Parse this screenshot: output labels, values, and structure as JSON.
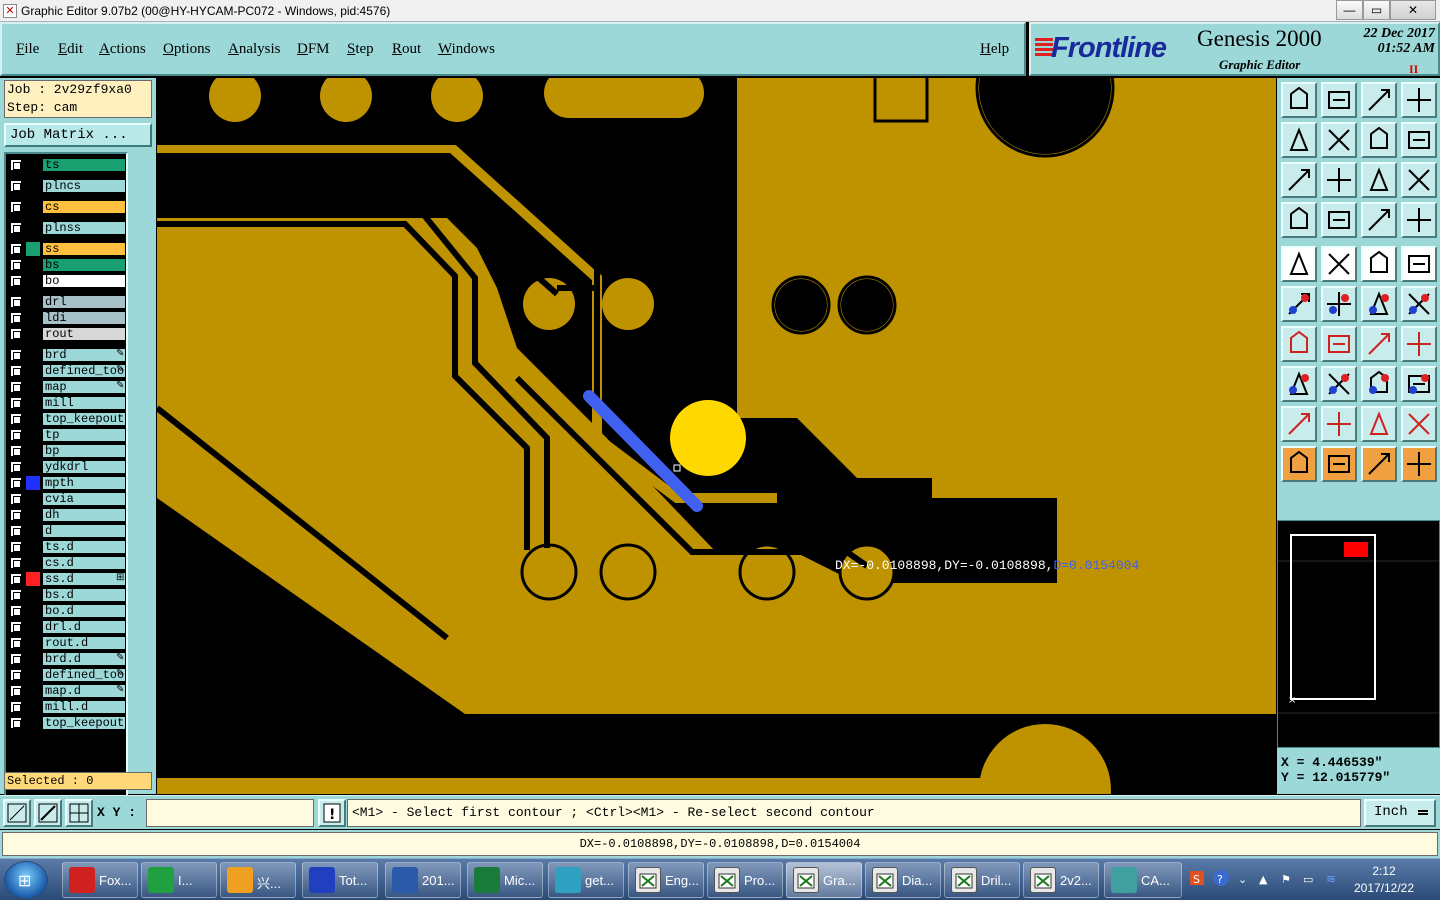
{
  "window": {
    "title": "Graphic Editor 9.07b2 (00@HY-HYCAM-PC072 - Windows, pid:4576)",
    "controls": [
      "—",
      "▭",
      "✕"
    ]
  },
  "menu": {
    "items": [
      "File",
      "Edit",
      "Actions",
      "Options",
      "Analysis",
      "DFM",
      "Step",
      "Rout",
      "Windows"
    ],
    "help": "Help"
  },
  "brand": {
    "logo": "Frontline",
    "product": "Genesis 2000",
    "date": "22 Dec 2017",
    "time": "01:52 AM",
    "subtitle": "Graphic Editor",
    "pause": "II"
  },
  "job": {
    "job_line": "Job : 2v29zf9xa0",
    "step_line": "Step: cam",
    "matrix_button": "Job Matrix ..."
  },
  "layers": [
    {
      "name": "ts",
      "bg": "#1aa070",
      "swatch": "#000000",
      "tag": ""
    },
    {
      "name": "plncs",
      "bg": "#9cd8d8",
      "swatch": "#000000",
      "tag": ""
    },
    {
      "name": "cs",
      "bg": "#ffc040",
      "swatch": "#000000",
      "tag": ""
    },
    {
      "name": "plnss",
      "bg": "#9cd8d8",
      "swatch": "#000000",
      "tag": ""
    },
    {
      "name": "ss",
      "bg": "#ffc040",
      "swatch": "#1aa070",
      "tag": ""
    },
    {
      "name": "bs",
      "bg": "#1aa070",
      "swatch": "#000000",
      "tag": ""
    },
    {
      "name": "bo",
      "bg": "#ffffff",
      "swatch": "#000000",
      "tag": ""
    },
    {
      "name": "drl",
      "bg": "#a8c0c8",
      "swatch": "#000000",
      "tag": ""
    },
    {
      "name": "ldi",
      "bg": "#a8c0c8",
      "swatch": "#000000",
      "tag": ""
    },
    {
      "name": "rout",
      "bg": "#d8d8d8",
      "swatch": "#000000",
      "tag": ""
    },
    {
      "name": "brd",
      "bg": "#9cd8d8",
      "swatch": "#000000",
      "tag": "✎"
    },
    {
      "name": "defined_tool",
      "bg": "#9cd8d8",
      "swatch": "#000000",
      "tag": "✎"
    },
    {
      "name": "map",
      "bg": "#9cd8d8",
      "swatch": "#000000",
      "tag": "✎"
    },
    {
      "name": "mill",
      "bg": "#9cd8d8",
      "swatch": "#000000",
      "tag": ""
    },
    {
      "name": "top_keepout",
      "bg": "#9cd8d8",
      "swatch": "#000000",
      "tag": ""
    },
    {
      "name": "tp",
      "bg": "#9cd8d8",
      "swatch": "#000000",
      "tag": ""
    },
    {
      "name": "bp",
      "bg": "#9cd8d8",
      "swatch": "#000000",
      "tag": ""
    },
    {
      "name": "ydkdrl",
      "bg": "#9cd8d8",
      "swatch": "#000000",
      "tag": ""
    },
    {
      "name": "mpth",
      "bg": "#9cd8d8",
      "swatch": "#2030ff",
      "tag": ""
    },
    {
      "name": "cvia",
      "bg": "#9cd8d8",
      "swatch": "#000000",
      "tag": ""
    },
    {
      "name": "dh",
      "bg": "#9cd8d8",
      "swatch": "#000000",
      "tag": ""
    },
    {
      "name": "d",
      "bg": "#9cd8d8",
      "swatch": "#000000",
      "tag": ""
    },
    {
      "name": "ts.d",
      "bg": "#9cd8d8",
      "swatch": "#000000",
      "tag": ""
    },
    {
      "name": "cs.d",
      "bg": "#9cd8d8",
      "swatch": "#000000",
      "tag": ""
    },
    {
      "name": "ss.d",
      "bg": "#9cd8d8",
      "swatch": "#ff2020",
      "tag": "⊞"
    },
    {
      "name": "bs.d",
      "bg": "#9cd8d8",
      "swatch": "#000000",
      "tag": ""
    },
    {
      "name": "bo.d",
      "bg": "#9cd8d8",
      "swatch": "#000000",
      "tag": ""
    },
    {
      "name": "drl.d",
      "bg": "#9cd8d8",
      "swatch": "#000000",
      "tag": ""
    },
    {
      "name": "rout.d",
      "bg": "#9cd8d8",
      "swatch": "#000000",
      "tag": ""
    },
    {
      "name": "brd.d",
      "bg": "#9cd8d8",
      "swatch": "#000000",
      "tag": "✎"
    },
    {
      "name": "defined_tool",
      "bg": "#9cd8d8",
      "swatch": "#000000",
      "tag": "✎"
    },
    {
      "name": "map.d",
      "bg": "#9cd8d8",
      "swatch": "#000000",
      "tag": "✎"
    },
    {
      "name": "mill.d",
      "bg": "#9cd8d8",
      "swatch": "#000000",
      "tag": ""
    },
    {
      "name": "top_keepout",
      "bg": "#9cd8d8",
      "swatch": "#000000",
      "tag": ""
    }
  ],
  "selected_label": "Selected : 0",
  "canvas": {
    "measure_prefix": "DX=-0.0108898,DY=-0.0108898,",
    "measure_d": "D=0.0154004",
    "copper_color": "#bf9300",
    "highlight_color": "#4060f0",
    "pad_color": "#ffd800"
  },
  "coords": {
    "x": "X = 4.446539\"",
    "y": "Y = 12.015779\""
  },
  "command": {
    "xy_label": "X Y :",
    "xy_value": "",
    "prompt": "<M1> - Select first contour ; <Ctrl><M1> - Re-select second contour",
    "units": "Inch"
  },
  "status_line": "DX=-0.0108898,DY=-0.0108898,D=0.0154004",
  "taskbar": {
    "start_icon": "windows-logo",
    "buttons": [
      {
        "label": "Fox...",
        "icon": "foxit-icon",
        "active": false
      },
      {
        "label": "I...",
        "icon": "app-icon",
        "active": false
      },
      {
        "label": "兴...",
        "icon": "shell-icon",
        "active": false
      },
      {
        "label": "Tot...",
        "icon": "floppy-icon",
        "active": false
      },
      {
        "label": "201...",
        "icon": "word-icon",
        "active": false
      },
      {
        "label": "Mic...",
        "icon": "excel-icon",
        "active": false
      },
      {
        "label": "get...",
        "icon": "eye-icon",
        "active": false
      },
      {
        "label": "Eng...",
        "icon": "genesis-icon",
        "active": false
      },
      {
        "label": "Pro...",
        "icon": "genesis-icon",
        "active": false
      },
      {
        "label": "Gra...",
        "icon": "genesis-icon",
        "active": true
      },
      {
        "label": "Dia...",
        "icon": "genesis-icon",
        "active": false
      },
      {
        "label": "Dril...",
        "icon": "genesis-icon",
        "active": false
      },
      {
        "label": "2v2...",
        "icon": "genesis-icon",
        "active": false
      },
      {
        "label": "CA...",
        "icon": "cam-icon",
        "active": false
      }
    ],
    "time": "2:12",
    "date": "2017/12/22"
  }
}
